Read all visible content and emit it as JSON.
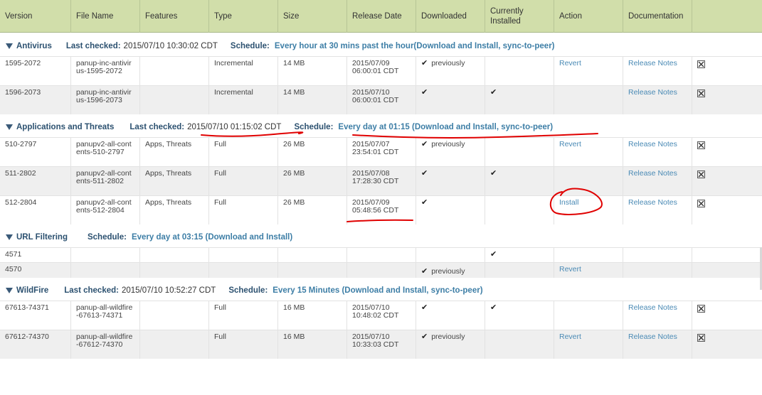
{
  "columns": [
    "Version",
    "File Name",
    "Features",
    "Type",
    "Size",
    "Release Date",
    "Downloaded",
    "Currently Installed",
    "Action",
    "Documentation",
    ""
  ],
  "groups": [
    {
      "name": "Antivirus",
      "last_checked_label": "Last checked:",
      "last_checked": "2015/07/10 10:30:02 CDT",
      "schedule_label": "Schedule:",
      "schedule": "Every hour at 30 mins past the hour(Download and Install, sync-to-peer)",
      "rows": [
        {
          "version": "1595-2072",
          "file": "panup-inc-antivirus-1595-2072",
          "features": "",
          "type": "Incremental",
          "size": "14 MB",
          "date": "2015/07/09 06:00:01 CDT",
          "downloaded": "✔",
          "downloaded_note": "previously",
          "installed": "",
          "action": "Revert",
          "doc": "Release Notes"
        },
        {
          "version": "1596-2073",
          "file": "panup-inc-antivirus-1596-2073",
          "features": "",
          "type": "Incremental",
          "size": "14 MB",
          "date": "2015/07/10 06:00:01 CDT",
          "downloaded": "✔",
          "downloaded_note": "",
          "installed": "✔",
          "action": "",
          "doc": "Release Notes"
        }
      ]
    },
    {
      "name": "Applications and Threats",
      "last_checked_label": "Last checked:",
      "last_checked": "2015/07/10 01:15:02 CDT",
      "schedule_label": "Schedule:",
      "schedule": "Every day at 01:15 (Download and Install, sync-to-peer)",
      "rows": [
        {
          "version": "510-2797",
          "file": "panupv2-all-contents-510-2797",
          "features": "Apps, Threats",
          "type": "Full",
          "size": "26 MB",
          "date": "2015/07/07 23:54:01 CDT",
          "downloaded": "✔",
          "downloaded_note": "previously",
          "installed": "",
          "action": "Revert",
          "doc": "Release Notes"
        },
        {
          "version": "511-2802",
          "file": "panupv2-all-contents-511-2802",
          "features": "Apps, Threats",
          "type": "Full",
          "size": "26 MB",
          "date": "2015/07/08 17:28:30 CDT",
          "downloaded": "✔",
          "downloaded_note": "",
          "installed": "✔",
          "action": "",
          "doc": "Release Notes"
        },
        {
          "version": "512-2804",
          "file": "panupv2-all-contents-512-2804",
          "features": "Apps, Threats",
          "type": "Full",
          "size": "26 MB",
          "date": "2015/07/09 05:48:56 CDT",
          "downloaded": "✔",
          "downloaded_note": "",
          "installed": "",
          "action": "Install",
          "doc": "Release Notes"
        }
      ]
    },
    {
      "name": "URL Filtering",
      "last_checked_label": "",
      "last_checked": "",
      "schedule_label": "Schedule:",
      "schedule": "Every day at 03:15 (Download and Install)",
      "rows": [
        {
          "version": "4571",
          "file": "",
          "features": "",
          "type": "",
          "size": "",
          "date": "",
          "downloaded": "",
          "downloaded_note": "",
          "installed": "✔",
          "action": "",
          "doc": ""
        },
        {
          "version": "4570",
          "file": "",
          "features": "",
          "type": "",
          "size": "",
          "date": "",
          "downloaded": "✔",
          "downloaded_note": "previously",
          "installed": "",
          "action": "Revert",
          "doc": ""
        }
      ]
    },
    {
      "name": "WildFire",
      "last_checked_label": "Last checked:",
      "last_checked": "2015/07/10 10:52:27 CDT",
      "schedule_label": "Schedule:",
      "schedule": "Every 15 Minutes (Download and Install, sync-to-peer)",
      "rows": [
        {
          "version": "67613-74371",
          "file": "panup-all-wildfire-67613-74371",
          "features": "",
          "type": "Full",
          "size": "16 MB",
          "date": "2015/07/10 10:48:02 CDT",
          "downloaded": "✔",
          "downloaded_note": "",
          "installed": "✔",
          "action": "",
          "doc": "Release Notes"
        },
        {
          "version": "67612-74370",
          "file": "panup-all-wildfire-67612-74370",
          "features": "",
          "type": "Full",
          "size": "16 MB",
          "date": "2015/07/10 10:33:03 CDT",
          "downloaded": "✔",
          "downloaded_note": "previously",
          "installed": "",
          "action": "Revert",
          "doc": "Release Notes"
        }
      ]
    }
  ],
  "colors": {
    "header_bg": "#d1deaa",
    "link": "#4a8ab5",
    "group_label": "#2c5170",
    "schedule": "#3d7ea6",
    "annotation": "#e00000"
  }
}
